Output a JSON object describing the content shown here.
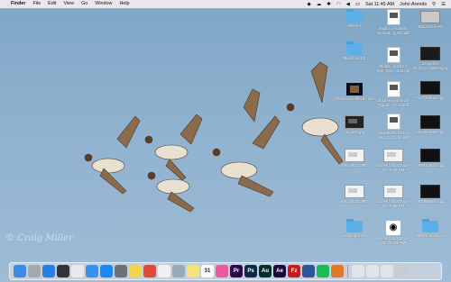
{
  "menubar": {
    "apple": "",
    "items": [
      "Finder",
      "File",
      "Edit",
      "View",
      "Go",
      "Window",
      "Help"
    ],
    "time": "Sat 11:45 AM",
    "user": "John Arends"
  },
  "watermark": "© Craig Miller",
  "desktop_icons": [
    {
      "label": "Ailerons"
    },
    {
      "label": "Studio...leClassic Sonaut...g_EN.pdf"
    },
    {
      "label": "Macintosh HD"
    },
    {
      "label": "Moonbox 1.0"
    },
    {
      "label": "Studio...nd242-1 Spe_Doc....243.pdf"
    },
    {
      "label": "Sequence 01.00_0...06023.jpg"
    },
    {
      "label": "Thumbnail effects .psd"
    },
    {
      "label": "2018 Hey Hannah Trappe...of-12.pdf"
    },
    {
      "label": "722729008.mp4"
    },
    {
      "label": "success.jpg"
    },
    {
      "label": "83150020703014 19_02_21_26.pdf"
    },
    {
      "label": "686091308.mp4"
    },
    {
      "label": "IMG_6021.JPG"
    },
    {
      "label": "Screen Shot 2016-03...5.43 PM"
    },
    {
      "label": "769971502.mp4"
    },
    {
      "label": "IMG_6022.JPG"
    },
    {
      "label": "Screen Shot 2016-03...8.58 PM"
    },
    {
      "label": "687098840.mp4"
    },
    {
      "label": "Desktop Icons"
    },
    {
      "label": "Screen Shot 2016-03...37.31 PM"
    },
    {
      "label": "Untitled Session 1"
    }
  ],
  "dock": [
    {
      "name": "finder",
      "color": "#3d8be0"
    },
    {
      "name": "launchpad",
      "color": "#a7a7b0"
    },
    {
      "name": "safari",
      "color": "#2a7ee0"
    },
    {
      "name": "photos",
      "color": "#333"
    },
    {
      "name": "calendar",
      "color": "#e9e9e9"
    },
    {
      "name": "mail",
      "color": "#3c8fe8"
    },
    {
      "name": "app-store",
      "color": "#1d89f0"
    },
    {
      "name": "system-preferences",
      "color": "#6f6f78"
    },
    {
      "name": "notes",
      "color": "#f2d54e"
    },
    {
      "name": "chrome",
      "color": "#dd4b39"
    },
    {
      "name": "textedit",
      "color": "#f0f0f0"
    },
    {
      "name": "preview",
      "color": "#9ab"
    },
    {
      "name": "stickies",
      "color": "#f5e37a"
    },
    {
      "name": "calendar-31",
      "color": "#fafafa"
    },
    {
      "name": "itunes",
      "color": "#ea5aa0"
    },
    {
      "name": "premiere",
      "color": "#2a0a48"
    },
    {
      "name": "photoshop",
      "color": "#0c2a48"
    },
    {
      "name": "audition",
      "color": "#062e2a"
    },
    {
      "name": "after-effects",
      "color": "#1e0a3a"
    },
    {
      "name": "filezilla",
      "color": "#bf1f1f"
    },
    {
      "name": "word",
      "color": "#2b579a"
    },
    {
      "name": "spotify",
      "color": "#1db954"
    },
    {
      "name": "books",
      "color": "#e07a28"
    },
    {
      "name": "downloads-stack",
      "color": "#dfe3ea"
    },
    {
      "name": "documents-stack",
      "color": "#dfe3ea"
    },
    {
      "name": "desktop-stack",
      "color": "#dfe3ea"
    },
    {
      "name": "trash",
      "color": "#c8ccd3"
    }
  ],
  "dock_labels": {
    "premiere": "Pr",
    "photoshop": "Ps",
    "audition": "Au",
    "after-effects": "Ae",
    "filezilla": "Fz",
    "calendar-31": "31"
  }
}
